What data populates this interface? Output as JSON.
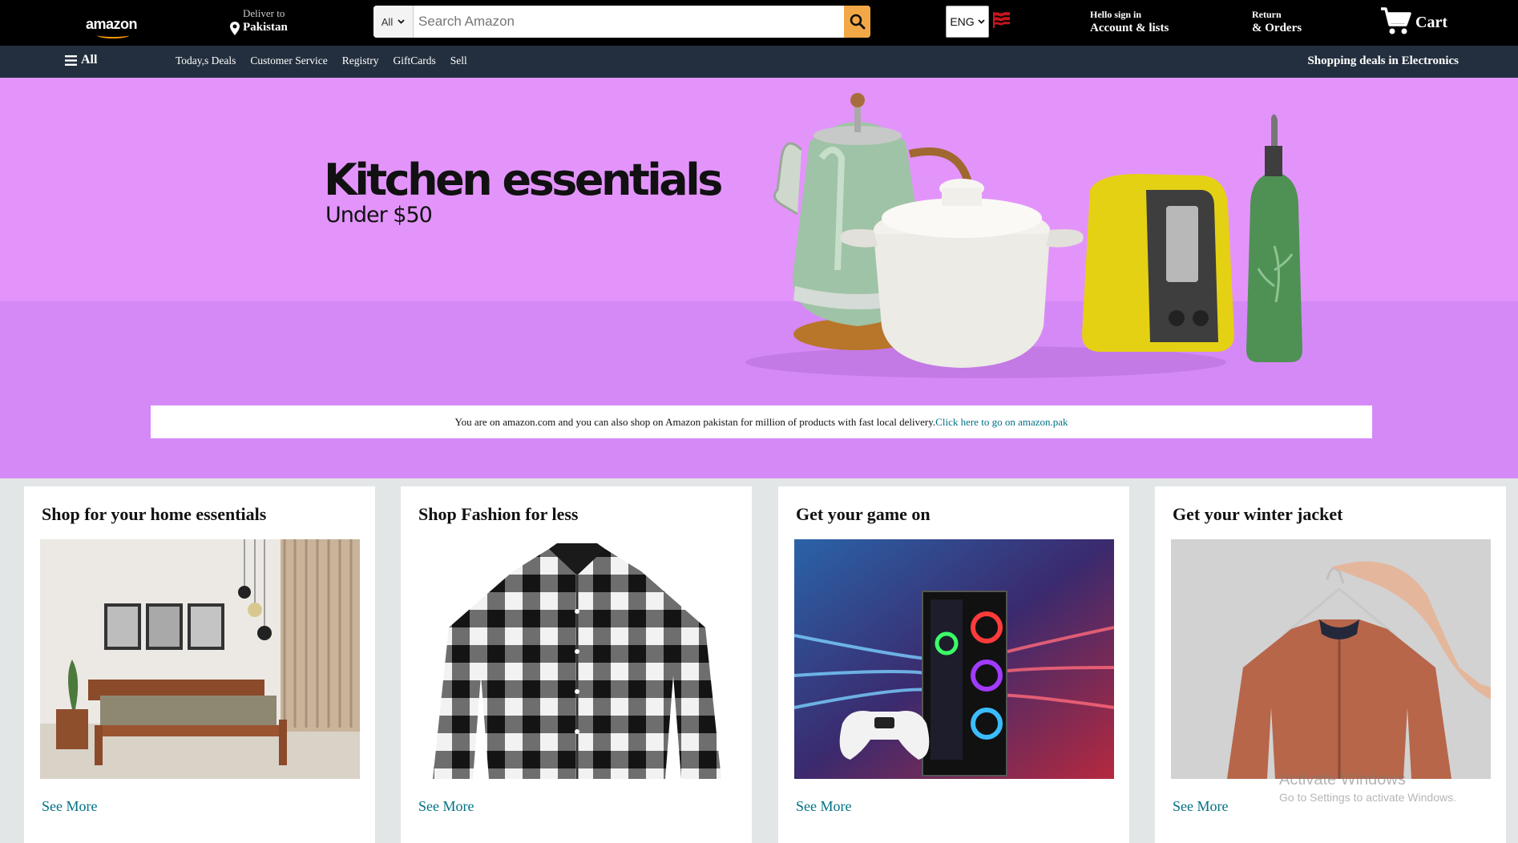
{
  "header": {
    "logo_text": "amazon",
    "deliver_line1": "Deliver to",
    "deliver_line2": "Pakistan",
    "search_category": "All",
    "search_placeholder": "Search Amazon",
    "language": "ENG",
    "account_line1": "Hello sign in",
    "account_line2": "Account & lists",
    "returns_line1": "Return",
    "returns_line2": "& Orders",
    "cart_label": "Cart"
  },
  "subnav": {
    "all_label": "All",
    "links": [
      "Today,s Deals",
      "Customer Service",
      "Registry",
      "GiftCards",
      "Sell"
    ],
    "promo": "Shopping deals in Electronics"
  },
  "hero": {
    "title": "Kitchen essentials",
    "subtitle": "Under $50"
  },
  "notice": {
    "text": "You are on amazon.com and you can also shop on Amazon pakistan for million of products with fast local delivery.",
    "link": "Click here to go on amazon.pak"
  },
  "cards": [
    {
      "title": "Shop for your home essentials",
      "link": "See More"
    },
    {
      "title": "Shop Fashion for less",
      "link": "See More"
    },
    {
      "title": "Get your game on",
      "link": "See More"
    },
    {
      "title": "Get your winter jacket",
      "link": "See More"
    }
  ],
  "watermark": {
    "line1": "Activate Windows",
    "line2": "Go to Settings to activate Windows."
  },
  "colors": {
    "topbar": "#000000",
    "subnav": "#232f3e",
    "search_button": "#f3a847",
    "hero_top": "#e394fb",
    "hero_bottom": "#d589f7",
    "link": "#007185",
    "page_bg": "#e3e6e6"
  },
  "icons": [
    "location-pin-icon",
    "chevron-down-icon",
    "search-icon",
    "flag-icon",
    "cart-icon",
    "hamburger-icon"
  ]
}
